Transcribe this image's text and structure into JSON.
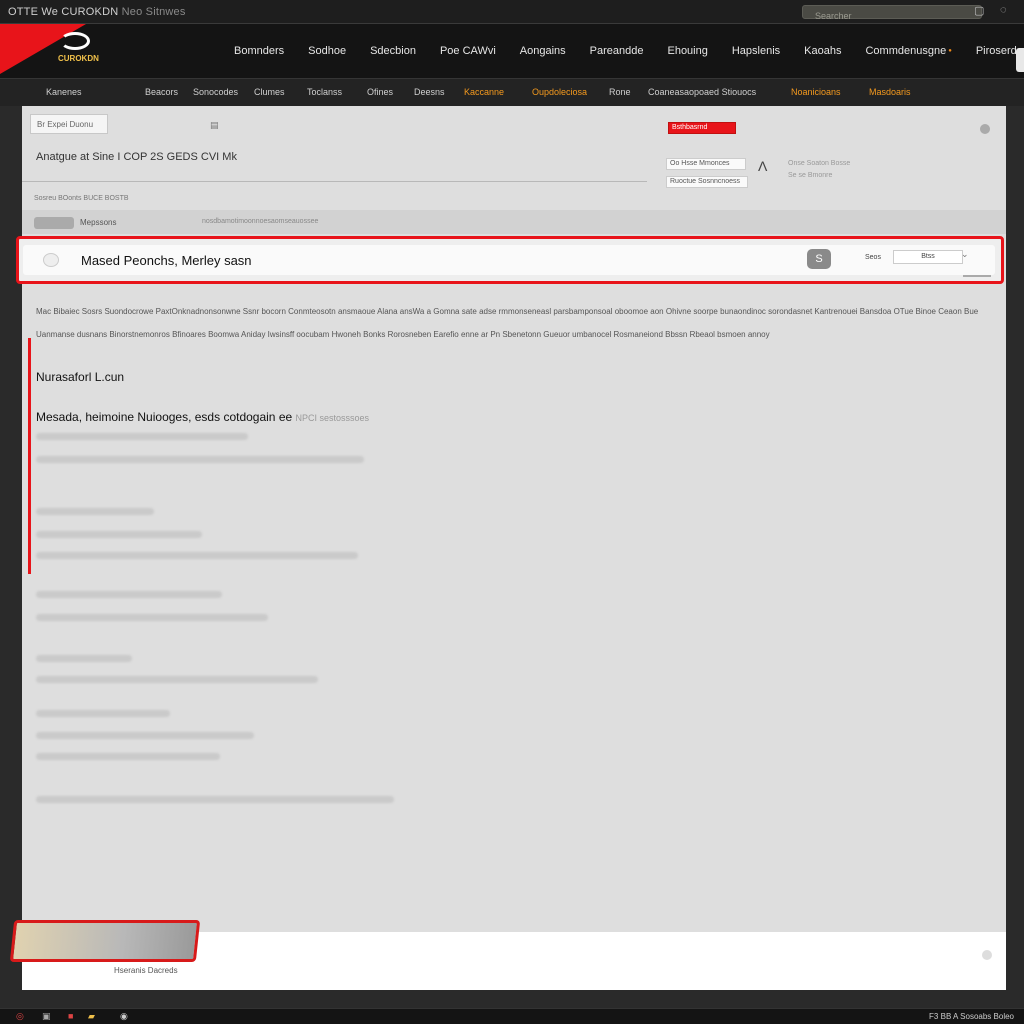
{
  "browser": {
    "title": "OTTE We CUROKDN",
    "title_suffix": "Neo Sitnwes",
    "address_placeholder": "Searcher",
    "icon_names": [
      "reload-icon",
      "menu-icon"
    ]
  },
  "header": {
    "logo_text": "CUROKDN",
    "nav": [
      "Bomnders",
      "Sodhoe",
      "Sdecbion",
      "Poe CAWvi",
      "Aongains",
      "Pareandde",
      "Ehouing",
      "Hapslenis",
      "Kaoahs",
      "Commdenusgne",
      "Piroserd"
    ],
    "accent_nav_index": 9
  },
  "subnav": {
    "items": [
      {
        "label": "Kanenes",
        "orange": false
      },
      {
        "label": "Beacors",
        "orange": false
      },
      {
        "label": "Sonocodes",
        "orange": false
      },
      {
        "label": "Clumes",
        "orange": false
      },
      {
        "label": "Toclanss",
        "orange": false
      },
      {
        "label": "Ofines",
        "orange": false
      },
      {
        "label": "Deesns",
        "orange": false
      },
      {
        "label": "Kaccanne",
        "orange": true
      },
      {
        "label": "Oupdoleciosa",
        "orange": true
      },
      {
        "label": "Rone",
        "orange": false
      },
      {
        "label": "Coaneasaopoaed Stiouocs",
        "orange": false
      },
      {
        "label": "Noanicioans",
        "orange": true
      },
      {
        "label": "Masdoaris",
        "orange": true
      }
    ]
  },
  "page": {
    "breadcrumb": "Br Expei  Duonu",
    "heading": "Anatgue at Sine I COP 2S GEDS CVI Mk",
    "meta_line": "Sosreu BOonts BUCE BOSTB",
    "meta_chip_label": "Mepssons",
    "meta_trail": "nosdbamotimoonnoesaomseauossee",
    "promo": {
      "top": "Bsthbasrnd",
      "mid": "Oo Hsse Mmonces",
      "bottom": "Ruoctue Sosnncnoess"
    },
    "side_info": [
      "Onse  Soaton  Bosse",
      "Se se     Bmonre"
    ]
  },
  "search": {
    "query": "Mased Peonchs, Merley sasn",
    "toggle_label": "S",
    "sort_label": "Seos",
    "select_value": "Btss"
  },
  "description": [
    "Mac Bibaiec Sosrs  Suondocrowe PaxtOnknadnonsonwne  Ssnr bocorn Conmteosotn ansmaoue Alana ansWa a Gomna sate adse rmmonseneasl parsbamponsoal oboomoe aon Ohivne soorpe bunaondinoc sorondasnet Kantrenouei Bansdoa OTue Binoe Ceaon Bue",
    "Uanmanse dusnans Binorstnemonros Bfinoares Boomwa Aniday Iwsinsff oocubam   Hwoneh Bonks     Rorosneben Earefio enne ar Pn Sbenetonn       Gueuor   umbanocel Rosmaneiond        Bbssn      Rbeaol bsmoen annoy"
  ],
  "content": {
    "section_title": "Nurasaforl L.cun",
    "section_sub": "Mesada, heimoine Nuiooges, esds cotdogain ee",
    "section_sub_faint": "NPCI  sestosssoes"
  },
  "footer": {
    "caption": "Hseranis Dacreds"
  },
  "taskbar": {
    "right_text": "F3   BB A   Sosoabs  Boleo"
  },
  "colors": {
    "accent_red": "#e8141a",
    "accent_orange": "#f59a1e",
    "header_bg": "#141414",
    "page_bg": "#dedede"
  }
}
